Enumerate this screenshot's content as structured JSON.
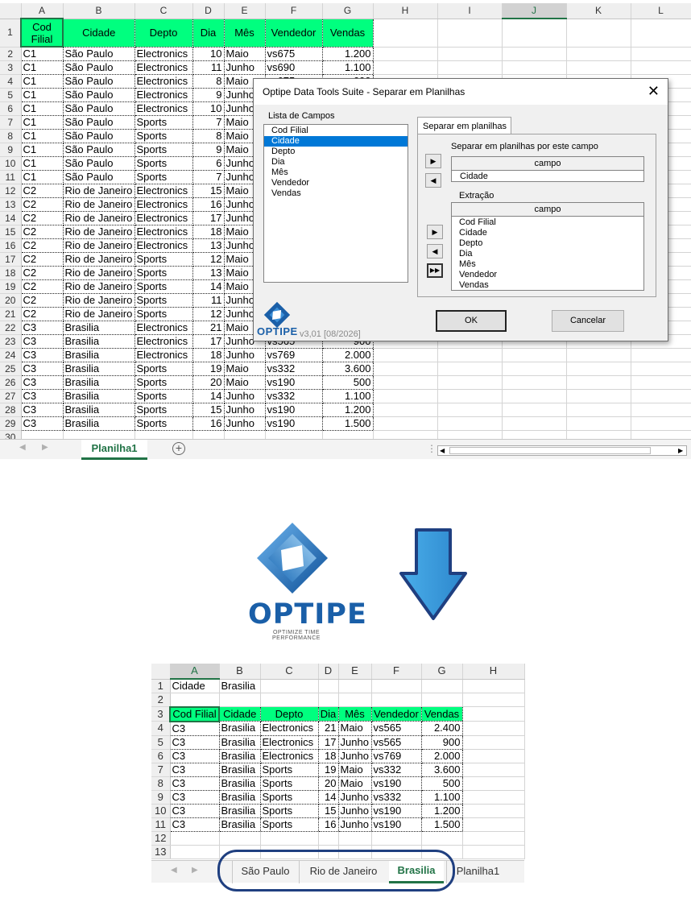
{
  "top_sheet": {
    "columns": [
      "A",
      "B",
      "C",
      "D",
      "E",
      "F",
      "G",
      "H",
      "I",
      "J",
      "K",
      "L"
    ],
    "selected_column": "J",
    "header_row": {
      "cod_filial": "Cod Filial",
      "cidade": "Cidade",
      "depto": "Depto",
      "dia": "Dia",
      "mes": "Mês",
      "vendedor": "Vendedor",
      "vendas": "Vendas"
    },
    "rows": [
      [
        "C1",
        "São Paulo",
        "Electronics",
        "10",
        "Maio",
        "vs675",
        "1.200"
      ],
      [
        "C1",
        "São Paulo",
        "Electronics",
        "11",
        "Junho",
        "vs690",
        "1.100"
      ],
      [
        "C1",
        "São Paulo",
        "Electronics",
        "8",
        "Maio",
        "vs675",
        "600"
      ],
      [
        "C1",
        "São Paulo",
        "Electronics",
        "9",
        "Junho",
        "",
        ""
      ],
      [
        "C1",
        "São Paulo",
        "Electronics",
        "10",
        "Junho",
        "",
        ""
      ],
      [
        "C1",
        "São Paulo",
        "Sports",
        "7",
        "Maio",
        "",
        ""
      ],
      [
        "C1",
        "São Paulo",
        "Sports",
        "8",
        "Maio",
        "",
        ""
      ],
      [
        "C1",
        "São Paulo",
        "Sports",
        "9",
        "Maio",
        "",
        ""
      ],
      [
        "C1",
        "São Paulo",
        "Sports",
        "6",
        "Junho",
        "",
        ""
      ],
      [
        "C1",
        "São Paulo",
        "Sports",
        "7",
        "Junho",
        "",
        ""
      ],
      [
        "C2",
        "Rio de Janeiro",
        "Electronics",
        "15",
        "Maio",
        "",
        ""
      ],
      [
        "C2",
        "Rio de Janeiro",
        "Electronics",
        "16",
        "Junho",
        "",
        ""
      ],
      [
        "C2",
        "Rio de Janeiro",
        "Electronics",
        "17",
        "Junho",
        "",
        ""
      ],
      [
        "C2",
        "Rio de Janeiro",
        "Electronics",
        "18",
        "Maio",
        "",
        ""
      ],
      [
        "C2",
        "Rio de Janeiro",
        "Electronics",
        "13",
        "Junho",
        "",
        ""
      ],
      [
        "C2",
        "Rio de Janeiro",
        "Sports",
        "12",
        "Maio",
        "",
        ""
      ],
      [
        "C2",
        "Rio de Janeiro",
        "Sports",
        "13",
        "Maio",
        "",
        ""
      ],
      [
        "C2",
        "Rio de Janeiro",
        "Sports",
        "14",
        "Maio",
        "",
        ""
      ],
      [
        "C2",
        "Rio de Janeiro",
        "Sports",
        "11",
        "Junho",
        "",
        ""
      ],
      [
        "C2",
        "Rio de Janeiro",
        "Sports",
        "12",
        "Junho",
        "",
        ""
      ],
      [
        "C3",
        "Brasilia",
        "Electronics",
        "21",
        "Maio",
        "",
        ""
      ],
      [
        "C3",
        "Brasilia",
        "Electronics",
        "17",
        "Junho",
        "vs565",
        "900"
      ],
      [
        "C3",
        "Brasilia",
        "Electronics",
        "18",
        "Junho",
        "vs769",
        "2.000"
      ],
      [
        "C3",
        "Brasilia",
        "Sports",
        "19",
        "Maio",
        "vs332",
        "3.600"
      ],
      [
        "C3",
        "Brasilia",
        "Sports",
        "20",
        "Maio",
        "vs190",
        "500"
      ],
      [
        "C3",
        "Brasilia",
        "Sports",
        "14",
        "Junho",
        "vs332",
        "1.100"
      ],
      [
        "C3",
        "Brasilia",
        "Sports",
        "15",
        "Junho",
        "vs190",
        "1.200"
      ],
      [
        "C3",
        "Brasilia",
        "Sports",
        "16",
        "Junho",
        "vs190",
        "1.500"
      ]
    ],
    "last_row_number": "30",
    "sheet_tab": "Planilha1",
    "add_sheet_icon": "plus-circle-icon"
  },
  "dialog": {
    "title": "Optipe Data Tools Suite - Separar em Planilhas",
    "close_label": "✕",
    "fields_label": "Lista de Campos",
    "fields": [
      "Cod Filial",
      "Cidade",
      "Depto",
      "Dia",
      "Mês",
      "Vendedor",
      "Vendas"
    ],
    "selected_field": "Cidade",
    "tab_label": "Separar em planilhas",
    "split_label": "Separar em planilhas por este campo",
    "column_header": "campo",
    "split_value": "Cidade",
    "extract_label": "Extração",
    "extract_fields": [
      "Cod Filial",
      "Cidade",
      "Depto",
      "Dia",
      "Mês",
      "Vendedor",
      "Vendas"
    ],
    "version": "v3,01 [08/2026]",
    "logo_text": "OPTIPE",
    "ok_label": "OK",
    "cancel_label": "Cancelar"
  },
  "logo": {
    "name": "OPTIPE",
    "tagline": "OPTIMIZE TIME PERFORMANCE",
    "color": "#1a5fa8"
  },
  "arrow": {
    "color": "#3aa0e0",
    "border": "#1f3f80"
  },
  "bottom_sheet": {
    "columns": [
      "A",
      "B",
      "C",
      "D",
      "E",
      "F",
      "G",
      "H"
    ],
    "selected_column": "A",
    "row1": {
      "label": "Cidade",
      "value": "Brasilia"
    },
    "header_row": {
      "cod_filial": "Cod Filial",
      "cidade": "Cidade",
      "depto": "Depto",
      "dia": "Dia",
      "mes": "Mês",
      "vendedor": "Vendedor",
      "vendas": "Vendas"
    },
    "rows": [
      [
        "C3",
        "Brasilia",
        "Electronics",
        "21",
        "Maio",
        "vs565",
        "2.400"
      ],
      [
        "C3",
        "Brasilia",
        "Electronics",
        "17",
        "Junho",
        "vs565",
        "900"
      ],
      [
        "C3",
        "Brasilia",
        "Electronics",
        "18",
        "Junho",
        "vs769",
        "2.000"
      ],
      [
        "C3",
        "Brasilia",
        "Sports",
        "19",
        "Maio",
        "vs332",
        "3.600"
      ],
      [
        "C3",
        "Brasilia",
        "Sports",
        "20",
        "Maio",
        "vs190",
        "500"
      ],
      [
        "C3",
        "Brasilia",
        "Sports",
        "14",
        "Junho",
        "vs332",
        "1.100"
      ],
      [
        "C3",
        "Brasilia",
        "Sports",
        "15",
        "Junho",
        "vs190",
        "1.200"
      ],
      [
        "C3",
        "Brasilia",
        "Sports",
        "16",
        "Junho",
        "vs190",
        "1.500"
      ]
    ],
    "tabs": [
      "São Paulo",
      "Rio de Janeiro",
      "Brasilia",
      "Planilha1"
    ],
    "active_tab": "Brasilia",
    "highlight_color": "#1f3f80"
  },
  "colors": {
    "header_green": "#00ff7f",
    "excel_green": "#217346",
    "selection_blue": "#0078d7"
  }
}
